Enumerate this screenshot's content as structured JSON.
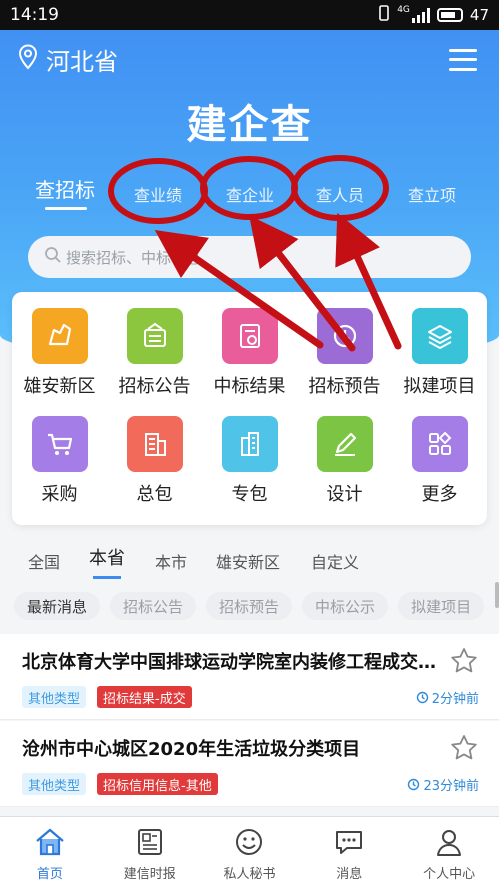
{
  "status": {
    "time": "14:19",
    "network": "4G",
    "battery": "47"
  },
  "header": {
    "location": "河北省",
    "app_title": "建企查"
  },
  "tabs": [
    "查招标",
    "查业绩",
    "查企业",
    "查人员",
    "查立项"
  ],
  "search": {
    "placeholder": "搜索招标、中标信息"
  },
  "features": [
    {
      "label": "雄安新区",
      "icon": "map-icon",
      "color": "#f5a623"
    },
    {
      "label": "招标公告",
      "icon": "announcement-icon",
      "color": "#8cc63f"
    },
    {
      "label": "中标结果",
      "icon": "document-icon",
      "color": "#e85d9a"
    },
    {
      "label": "招标预告",
      "icon": "clock-icon",
      "color": "#9b6bd6"
    },
    {
      "label": "拟建项目",
      "icon": "layers-icon",
      "color": "#38c3d8"
    },
    {
      "label": "采购",
      "icon": "cart-icon",
      "color": "#a57de6"
    },
    {
      "label": "总包",
      "icon": "building-icon",
      "color": "#f26a5a"
    },
    {
      "label": "专包",
      "icon": "tower-icon",
      "color": "#4fc3e8"
    },
    {
      "label": "设计",
      "icon": "pencil-icon",
      "color": "#7cc544"
    },
    {
      "label": "更多",
      "icon": "grid-icon",
      "color": "#a57de6"
    }
  ],
  "region_tabs": [
    "全国",
    "本省",
    "本市",
    "雄安新区",
    "自定义"
  ],
  "filter_chips": [
    "最新消息",
    "招标公告",
    "招标预告",
    "中标公示",
    "拟建项目"
  ],
  "news": [
    {
      "title": "北京体育大学中国排球运动学院室内装修工程成交公告",
      "tag1": "其他类型",
      "tag2": "招标结果-成交",
      "time": "2分钟前"
    },
    {
      "title": "沧州市中心城区2020年生活垃圾分类项目",
      "tag1": "其他类型",
      "tag2": "招标信用信息-其他",
      "time": "23分钟前"
    }
  ],
  "bottom_nav": [
    "首页",
    "建信时报",
    "私人秘书",
    "消息",
    "个人中心"
  ],
  "colors": {
    "primary": "#3d8bf0",
    "annotation": "#c40f14"
  }
}
